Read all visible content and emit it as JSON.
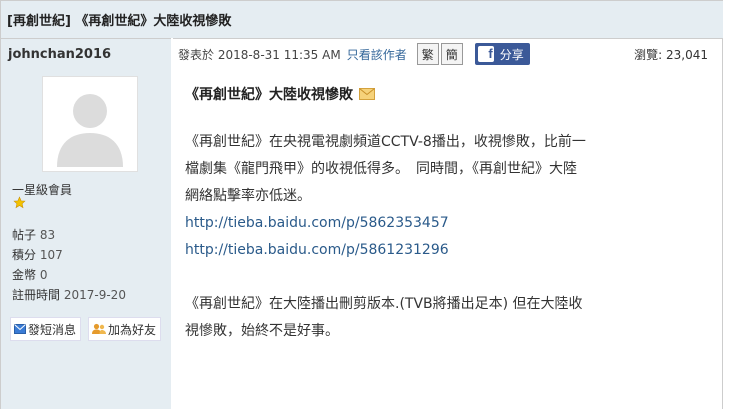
{
  "thread": {
    "title": "[再創世紀] 《再創世紀》大陸收視慘敗"
  },
  "author": {
    "name": "johnchan2016",
    "rank": "一星級會員",
    "stats": [
      {
        "label": "帖子",
        "value": "83"
      },
      {
        "label": "積分",
        "value": "107"
      },
      {
        "label": "金幣",
        "value": "0"
      },
      {
        "label": "註冊時間",
        "value": "2017-9-20"
      }
    ],
    "actions": {
      "pm": "發短消息",
      "friend": "加為好友"
    }
  },
  "post_header": {
    "time": "發表於 2018-8-31 11:35 AM",
    "only_author": "只看該作者",
    "trad": "繁",
    "simp": "簡",
    "share": "分享",
    "fb": "f",
    "views": "瀏覽: 23,041"
  },
  "post": {
    "subject": "《再創世紀》大陸收視慘敗",
    "lines": [
      "《再創世紀》在央視電視劇頻道CCTV-8播出，收視慘敗，比前一",
      "檔劇集《龍門飛甲》的收視低得多。　同時間，《再創世紀》大陸",
      "網絡點擊率亦低迷。"
    ],
    "links": [
      "http://tieba.baidu.com/p/5862353457",
      "http://tieba.baidu.com/p/5861231296"
    ],
    "lines2": [
      "《再創世紀》在大陸播出刪剪版本.(TVB將播出足本)  但在大陸收",
      "視慘敗，始終不是好事。"
    ]
  },
  "colors": {
    "header_bg": "#e5edf2",
    "link": "#336699",
    "facebook": "#3b5998",
    "border": "#cdcdcd"
  },
  "icons": [
    "avatar-placeholder-icon",
    "star-icon",
    "envelope-icon",
    "users-icon",
    "facebook-icon",
    "mail-icon"
  ]
}
